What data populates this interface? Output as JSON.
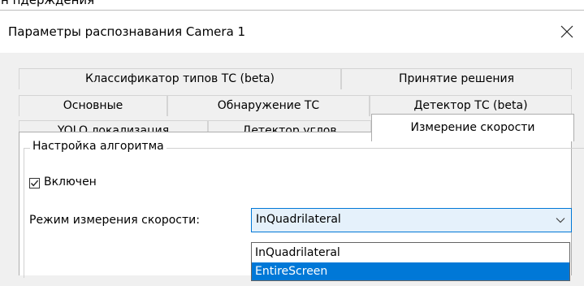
{
  "background_window": {
    "partial_text": "н пдерждения"
  },
  "dialog": {
    "title": "Параметры распознавания Camera 1"
  },
  "tabs": {
    "row1": [
      "Классификатор типов ТС (beta)",
      "Принятие решения"
    ],
    "row2": [
      "Основные",
      "Обнаружение ТС",
      "Детектор ТС (beta)"
    ],
    "row3": [
      "YOLO локализация",
      "Детектор углов",
      "Измерение скорости"
    ],
    "active": "Измерение скорости"
  },
  "group": {
    "legend": "Настройка алгоритма",
    "enabled": {
      "label": "Включен",
      "checked": true
    },
    "speed_mode": {
      "label": "Режим измерения скорости:",
      "value": "InQuadrilateral",
      "options": [
        "InQuadrilateral",
        "EntireScreen"
      ],
      "highlighted": "EntireScreen"
    }
  },
  "icons": {
    "close": "close-icon",
    "dropdown_arrow": "chevron-down-icon",
    "checkmark": "checkmark-icon"
  },
  "colors": {
    "accent": "#0078d7",
    "select_hover_bg": "#e5f1fb",
    "dialog_bg": "#f0f0f0",
    "panel_bg": "#ffffff"
  }
}
